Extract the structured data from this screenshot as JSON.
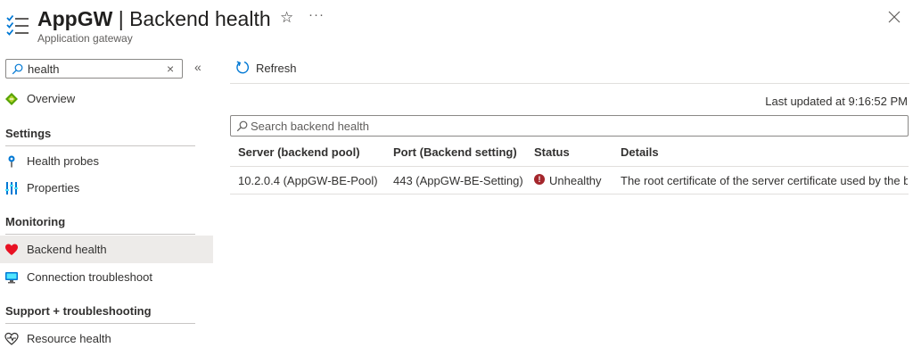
{
  "header": {
    "title_app": "AppGW",
    "title_sep": " | ",
    "title_page": "Backend health",
    "subtitle": "Application gateway",
    "star_icon": "star-icon",
    "more_icon": "more-icon",
    "close_icon": "close-icon"
  },
  "sidebar": {
    "search_value": "health",
    "overview_label": "Overview",
    "sections": {
      "settings": "Settings",
      "monitoring": "Monitoring",
      "support": "Support + troubleshooting"
    },
    "items": {
      "health_probes": "Health probes",
      "properties": "Properties",
      "backend_health": "Backend health",
      "connection_troubleshoot": "Connection troubleshoot",
      "resource_health": "Resource health"
    }
  },
  "main": {
    "refresh_label": "Refresh",
    "last_updated": "Last updated at 9:16:52 PM",
    "search_placeholder": "Search backend health",
    "columns": {
      "server": "Server (backend pool)",
      "port": "Port (Backend setting)",
      "status": "Status",
      "details": "Details"
    },
    "rows": [
      {
        "server": "10.2.0.4 (AppGW-BE-Pool)",
        "port": "443 (AppGW-BE-Setting)",
        "status": "Unhealthy",
        "details": "The root certificate of the server certificate used by the b..."
      }
    ]
  },
  "colors": {
    "accent": "#0078d4",
    "unhealthy": "#a4262c",
    "heart": "#e81123",
    "active_bg": "#edebe9"
  }
}
